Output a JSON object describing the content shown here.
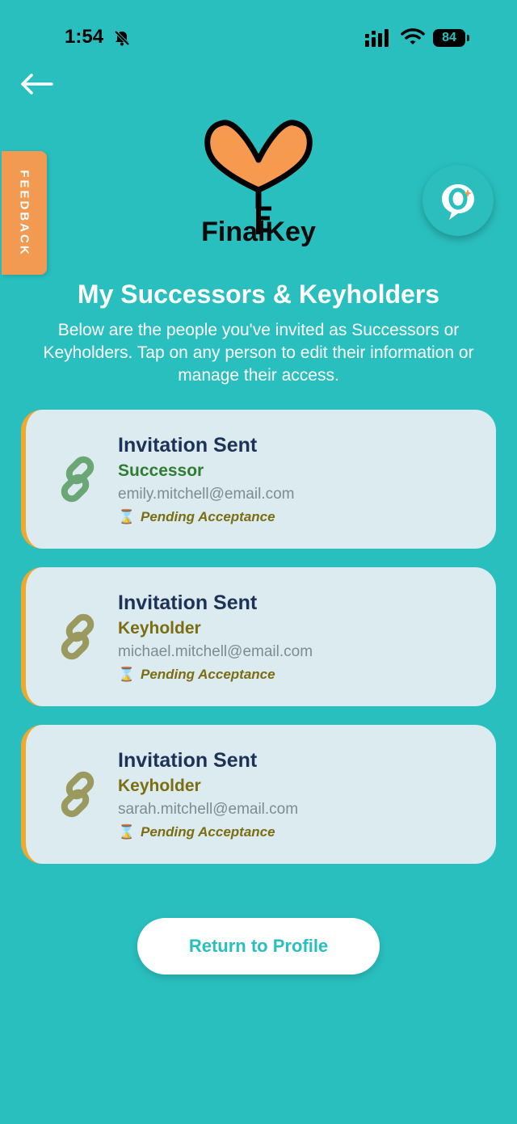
{
  "status_bar": {
    "time": "1:54",
    "battery": "84"
  },
  "feedback_tab": {
    "label": "FEEDBACK"
  },
  "logo": {
    "text": "FinalKey"
  },
  "page": {
    "title": "My Successors & Keyholders",
    "description": "Below are the people you've invited as Successors or Keyholders. Tap on any person to edit their information or manage their access."
  },
  "invitations": [
    {
      "title": "Invitation Sent",
      "role": "Successor",
      "email": "emily.mitchell@email.com",
      "status": "Pending Acceptance"
    },
    {
      "title": "Invitation Sent",
      "role": "Keyholder",
      "email": "michael.mitchell@email.com",
      "status": "Pending Acceptance"
    },
    {
      "title": "Invitation Sent",
      "role": "Keyholder",
      "email": "sarah.mitchell@email.com",
      "status": "Pending Acceptance"
    }
  ],
  "return_button": {
    "label": "Return to Profile"
  },
  "colors": {
    "background": "#2abfbf",
    "successor_role": "#2e7d32",
    "keyholder_role": "#7a6d12",
    "successor_icon": "#6aa774",
    "keyholder_icon": "#9a9a5e",
    "card_accent": "#eeaa2c",
    "heart": "#f59a4f"
  },
  "icons": {
    "back": "arrow-left-icon",
    "bell": "bell-slash-icon",
    "signal": "cellular-signal-icon",
    "wifi": "wifi-icon",
    "link": "link-icon",
    "hourglass": "hourglass-icon",
    "chat": "chat-assistant-icon"
  }
}
